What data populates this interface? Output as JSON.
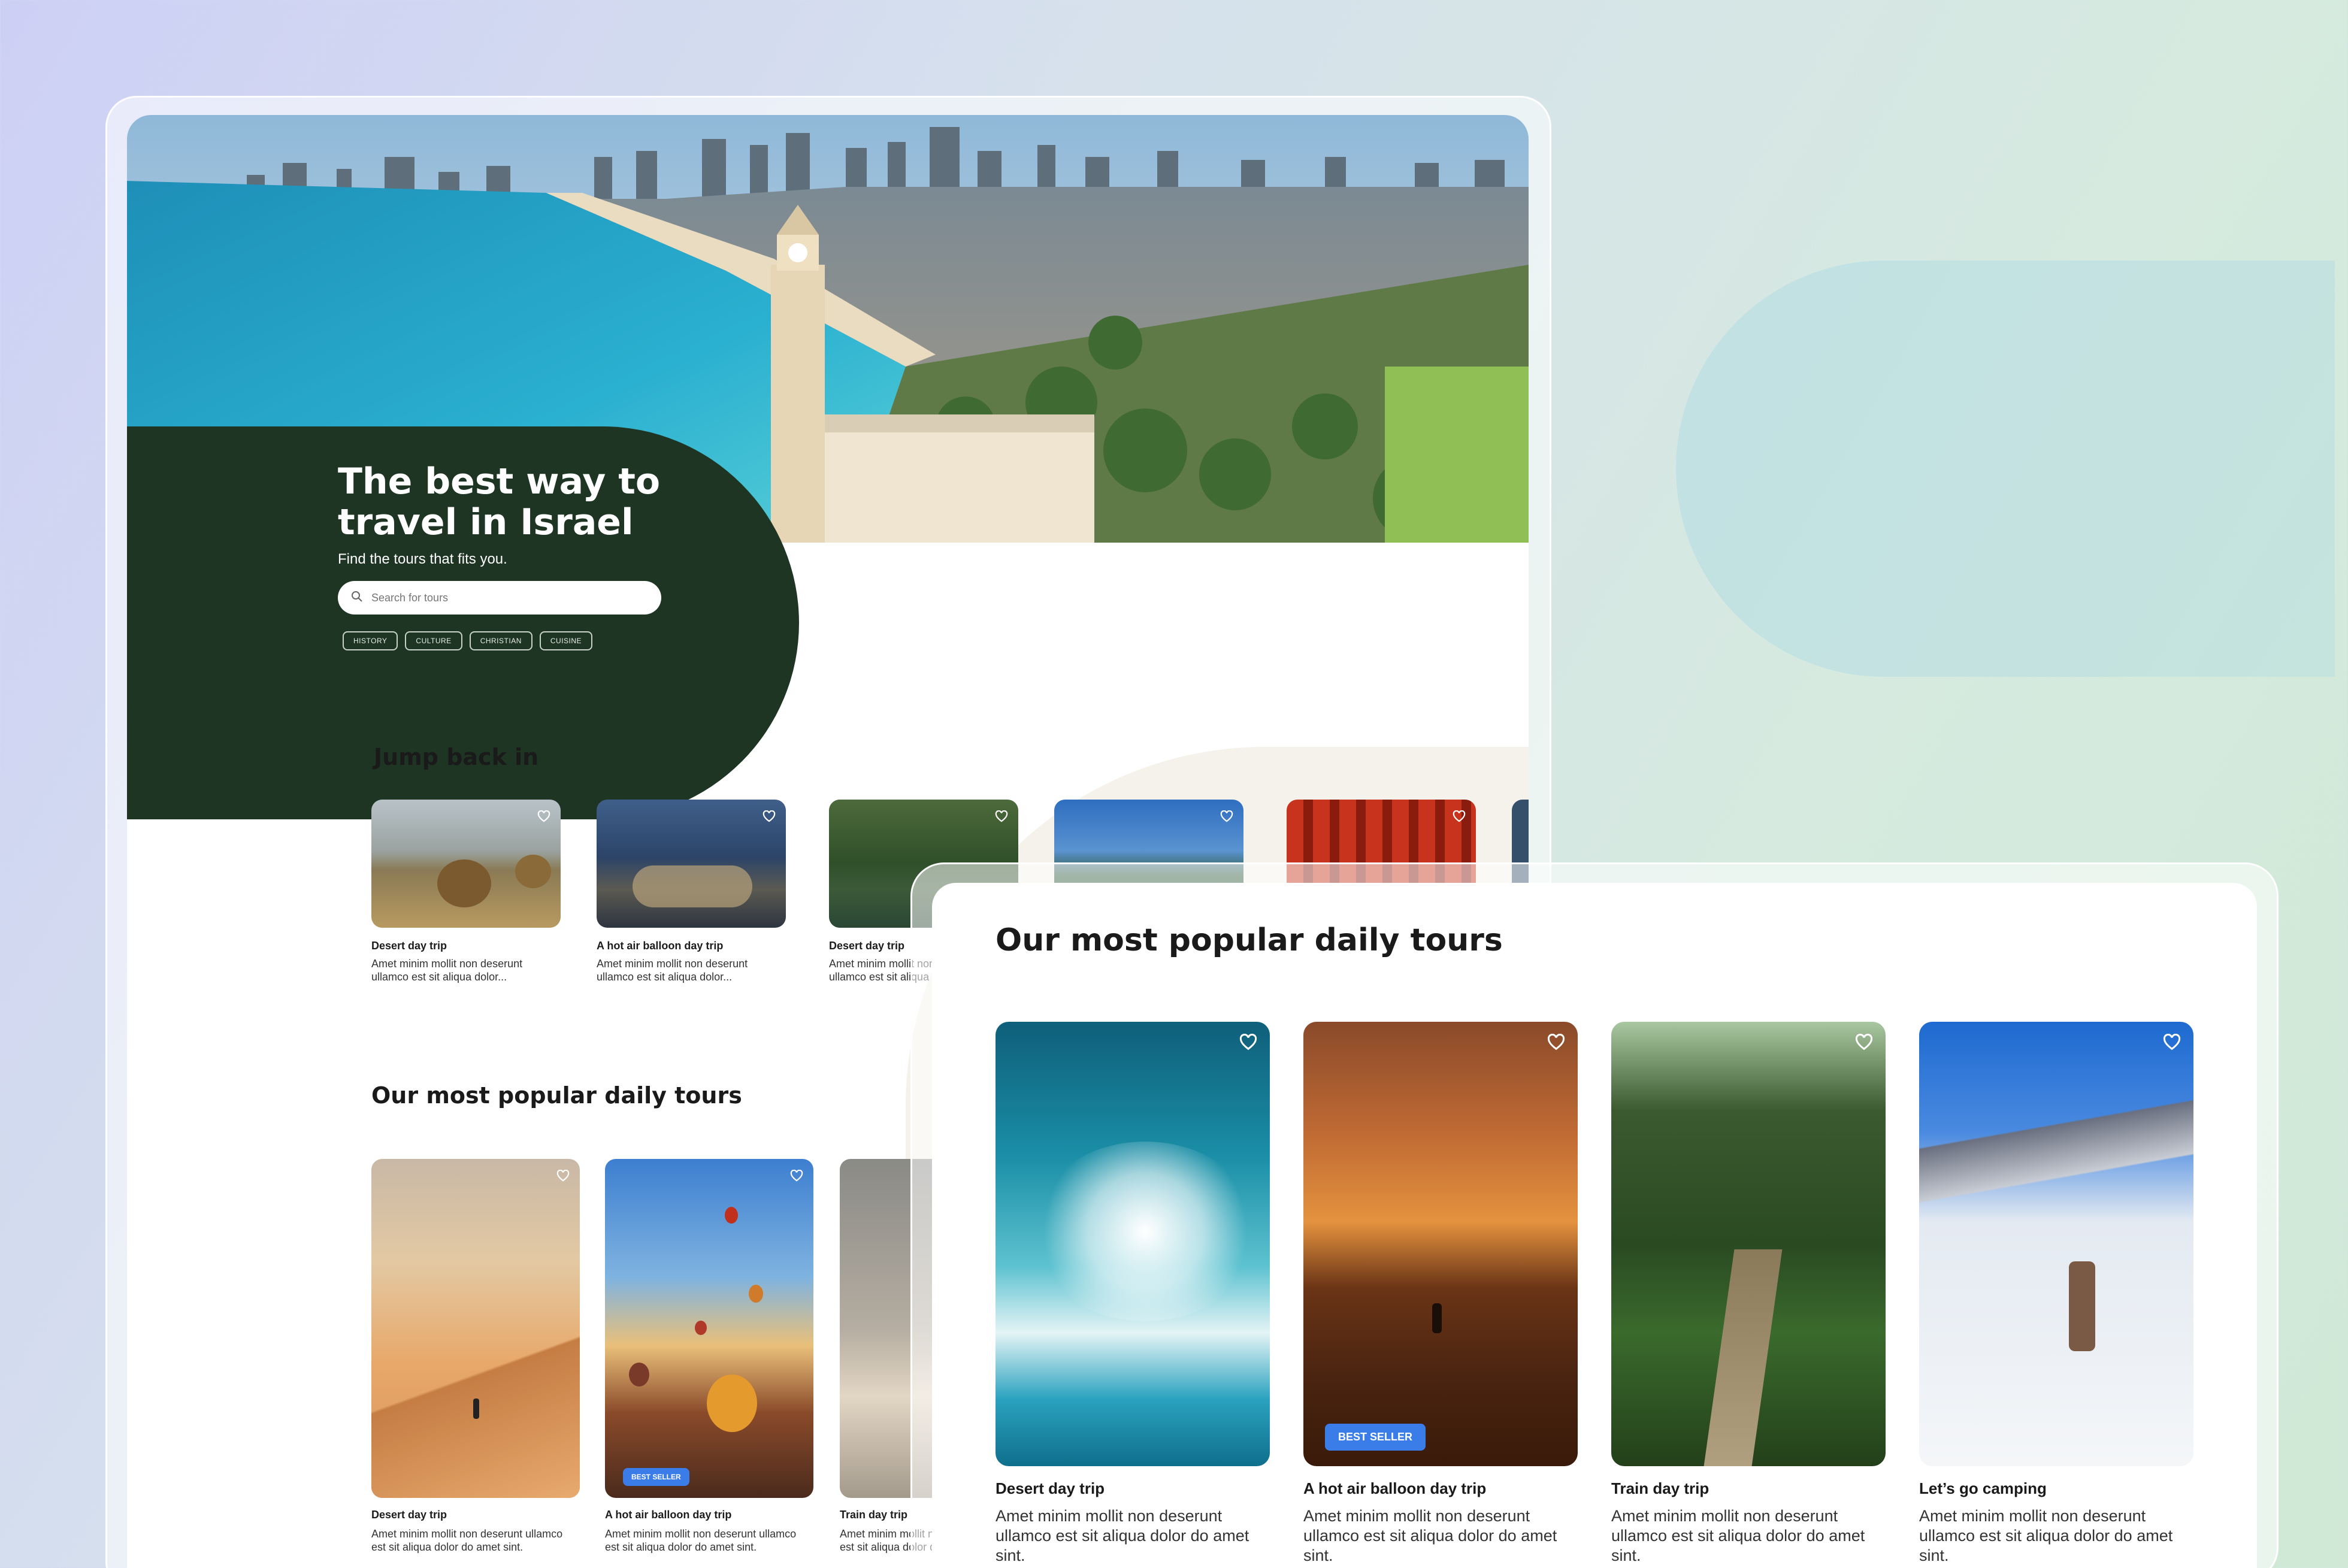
{
  "hero": {
    "title": "The best way to travel in Israel",
    "subtitle": "Find the tours that fits you.",
    "search_placeholder": "Search for tours",
    "chips": [
      "HISTORY",
      "CULTURE",
      "CHRISTIAN",
      "CUISINE"
    ]
  },
  "jump_back": {
    "title": "Jump back in",
    "cards": [
      {
        "title": "Desert day trip",
        "desc": "Amet minim mollit non deserunt ullamco est sit aliqua dolor..."
      },
      {
        "title": "A hot air balloon day trip",
        "desc": "Amet minim mollit non deserunt ullamco est sit aliqua dolor..."
      },
      {
        "title": "Desert day trip",
        "desc": "Amet minim mollit non deserunt ullamco est sit aliqua dolor..."
      }
    ]
  },
  "popular_back": {
    "title": "Our most popular daily tours",
    "cards": [
      {
        "title": "Desert day trip",
        "desc": "Amet minim mollit non deserunt ullamco est sit aliqua dolor do amet sint."
      },
      {
        "title": "A hot air balloon day trip",
        "desc": "Amet minim mollit non deserunt ullamco est sit aliqua dolor do amet sint.",
        "badge": "BEST SELLER"
      },
      {
        "title": "Train day trip",
        "desc": "Amet minim mollit non deserunt ullamco est sit aliqua dolor do amet sint."
      }
    ]
  },
  "popular_front": {
    "title": "Our most popular daily tours",
    "cards": [
      {
        "title": "Desert day trip",
        "desc": "Amet minim mollit non deserunt ullamco est sit aliqua dolor do amet sint."
      },
      {
        "title": "A hot air balloon day trip",
        "desc": "Amet minim mollit non deserunt ullamco est sit aliqua dolor do amet sint.",
        "badge": "BEST SELLER"
      },
      {
        "title": "Train day trip",
        "desc": "Amet minim mollit non deserunt ullamco est sit aliqua dolor do amet sint."
      },
      {
        "title": "Let’s go camping",
        "desc": "Amet minim mollit non deserunt ullamco est sit aliqua dolor do amet sint."
      }
    ]
  },
  "colors": {
    "hero_panel": "#1e3523",
    "badge": "#3b7de8"
  },
  "icons": {
    "favorite": "heart-icon",
    "search": "search-icon"
  }
}
